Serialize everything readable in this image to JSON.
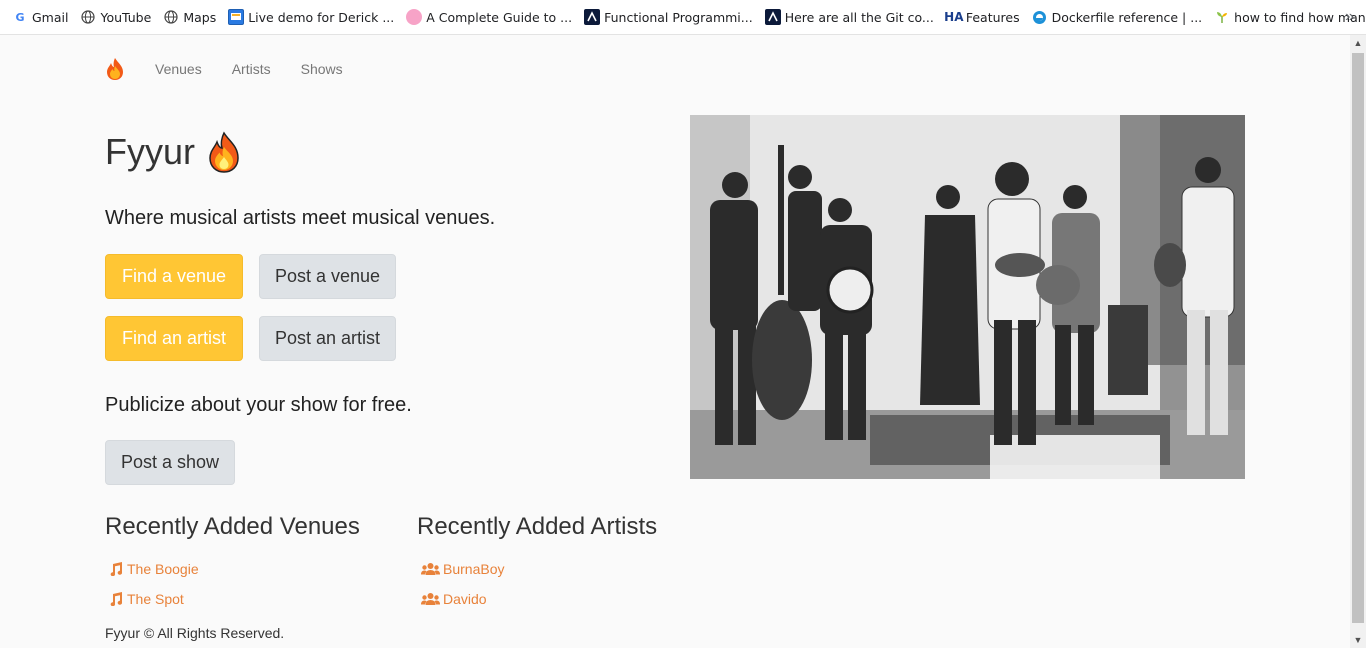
{
  "bookmarks": [
    {
      "icon": "google-icon",
      "label": "Gmail"
    },
    {
      "icon": "globe-icon",
      "label": "YouTube"
    },
    {
      "icon": "globe-icon",
      "label": "Maps"
    },
    {
      "icon": "demo-icon",
      "label": "Live demo for Derick ..."
    },
    {
      "icon": "pink-circle-icon",
      "label": "A Complete Guide to ..."
    },
    {
      "icon": "dev-logo-icon",
      "label": "Functional Programmi..."
    },
    {
      "icon": "dev-logo-icon",
      "label": "Here are all the Git co..."
    },
    {
      "icon": "ha-icon",
      "label": "Features"
    },
    {
      "icon": "docker-icon",
      "label": "Dockerfile reference | ..."
    },
    {
      "icon": "sprout-icon",
      "label": "how to find how man..."
    }
  ],
  "nav": {
    "links": [
      "Venues",
      "Artists",
      "Shows"
    ]
  },
  "hero": {
    "title": "Fyyur",
    "tagline": "Where musical artists meet musical venues.",
    "publicize": "Publicize about your show for free."
  },
  "buttons": {
    "find_venue": "Find a venue",
    "post_venue": "Post a venue",
    "find_artist": "Find an artist",
    "post_artist": "Post an artist",
    "post_show": "Post a show"
  },
  "recent_venues": {
    "title": "Recently Added Venues",
    "items": [
      "The Boogie",
      "The Spot"
    ]
  },
  "recent_artists": {
    "title": "Recently Added Artists",
    "items": [
      "BurnaBoy",
      "Davido"
    ]
  },
  "footer": "Fyyur © All Rights Reserved.",
  "colors": {
    "accent": "#ffc634",
    "link": "#e8823a",
    "light_button": "#dee2e6"
  }
}
